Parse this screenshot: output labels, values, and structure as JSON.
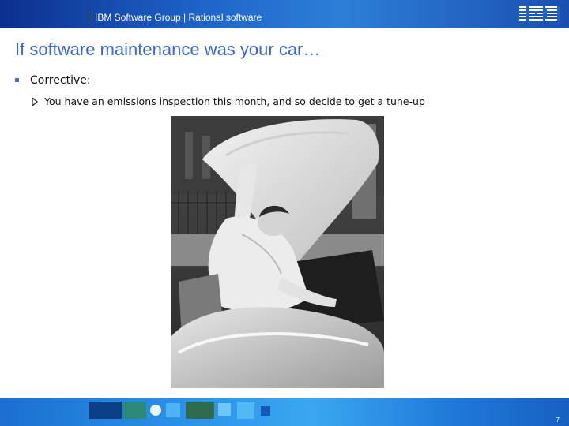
{
  "header": {
    "title": "IBM Software Group | Rational software",
    "logo_label": "IBM"
  },
  "slide": {
    "title": "If software maintenance was your car…",
    "bullets": [
      {
        "label": "Corrective",
        "suffix": ":"
      }
    ],
    "sub_bullets": [
      {
        "text": "You have an emissions inspection this month, and so decide to get a tune-up"
      }
    ],
    "photo_subject": "man-working-under-car-hood"
  },
  "footer": {
    "page_number": "7"
  },
  "colors": {
    "header_blue": "#1f63c8",
    "title_blue": "#3a66d4",
    "footer_blue": "#2a8fe6"
  }
}
